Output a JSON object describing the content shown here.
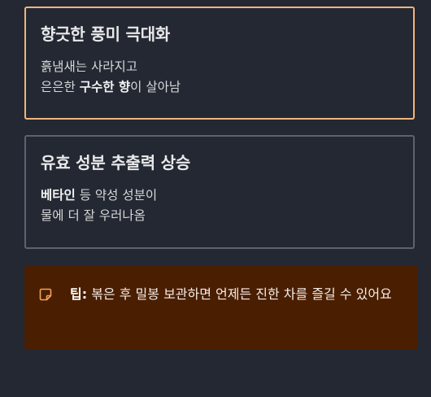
{
  "cards": [
    {
      "title": "향긋한 풍미 극대화",
      "line1": "흙냄새는 사라지고",
      "line2_prefix": "은은한 ",
      "line2_bold": "구수한 향",
      "line2_suffix": "이 살아남"
    },
    {
      "title": "유효 성분 추출력 상승",
      "line1_bold": "베타인",
      "line1_suffix": " 등 약성 성분이",
      "line2": "물에 더 잘 우러나옴"
    }
  ],
  "tip": {
    "icon": "note-icon",
    "label": "팁:",
    "text": " 볶은 후 밀봉 보관하면 언제든 진한 차를 즐길 수 있어요"
  },
  "colors": {
    "background": "#232833",
    "card1_border": "#f2b47a",
    "card2_border": "#5c6270",
    "tip_background": "#4a1e00",
    "tip_icon": "#f5a25d"
  }
}
